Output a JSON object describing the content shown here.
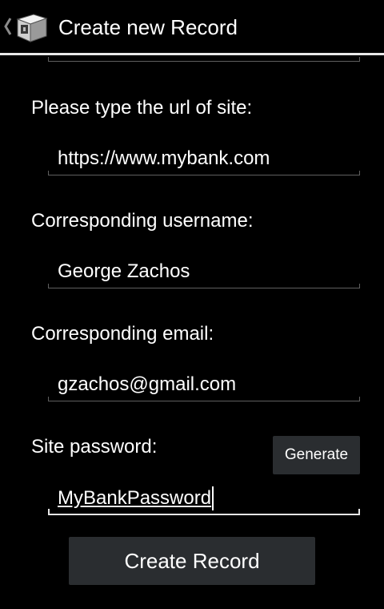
{
  "action_bar": {
    "title": "Create new Record",
    "back_icon": "chevron-left-icon",
    "app_icon": "cube-vault-icon"
  },
  "form": {
    "url": {
      "label": "Please type the url of site:",
      "value": "https://www.mybank.com"
    },
    "username": {
      "label": "Corresponding username:",
      "value": "George Zachos"
    },
    "email": {
      "label": "Corresponding email:",
      "value": "gzachos@gmail.com"
    },
    "password": {
      "label": "Site password:",
      "value": "MyBankPassword"
    },
    "generate_label": "Generate",
    "create_label": "Create Record"
  }
}
